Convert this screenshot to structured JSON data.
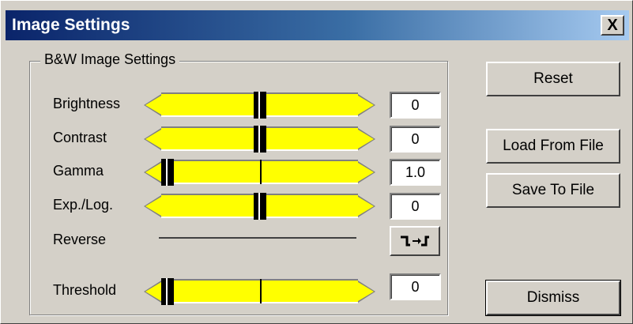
{
  "window": {
    "title": "Image Settings",
    "close_label": "X"
  },
  "group": {
    "label": "B&W Image Settings"
  },
  "sliders": [
    {
      "id": "brightness",
      "label": "Brightness",
      "value": "0",
      "position": 0.5
    },
    {
      "id": "contrast",
      "label": "Contrast",
      "value": "0",
      "position": 0.5
    },
    {
      "id": "gamma",
      "label": "Gamma",
      "value": "1.0",
      "position": 0.0
    },
    {
      "id": "exp-log",
      "label": "Exp./Log.",
      "value": "0",
      "position": 0.5
    },
    {
      "id": "threshold",
      "label": "Threshold",
      "value": "0",
      "position": 0.0
    }
  ],
  "reverse": {
    "label": "Reverse",
    "icon": "reverse-curve-icon"
  },
  "buttons": {
    "reset": "Reset",
    "load": "Load From File",
    "save": "Save To File",
    "dismiss": "Dismiss"
  },
  "colors": {
    "slider_track": "#ffff00",
    "title_start": "#0a246a",
    "title_end": "#a6caf0",
    "dialog_bg": "#d4d0c8"
  }
}
